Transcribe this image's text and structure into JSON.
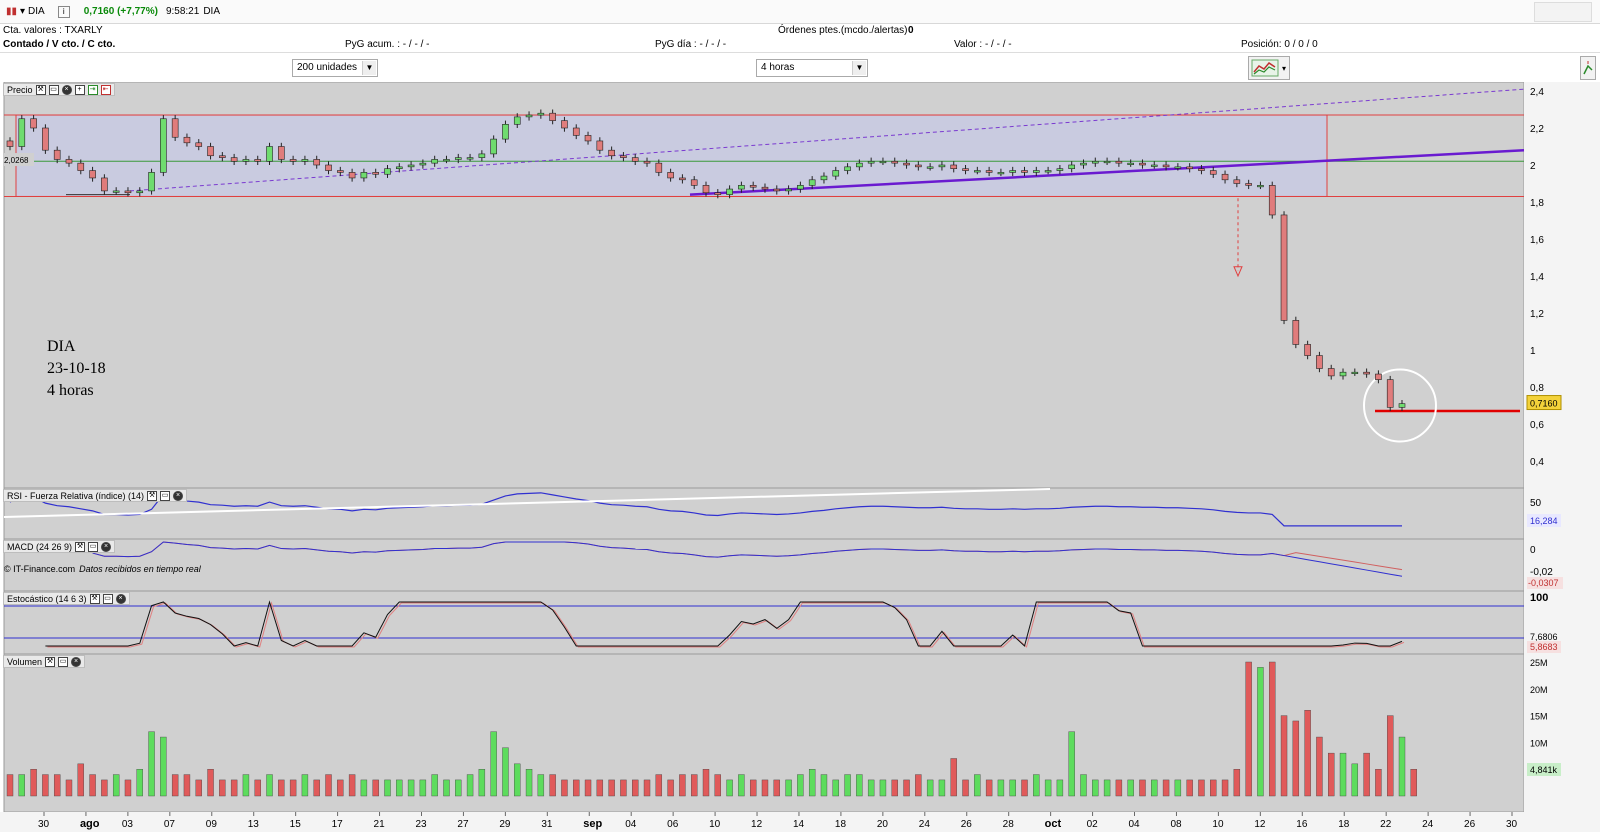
{
  "header": {
    "symbol": "DIA",
    "price": "0,7160 (+7,77%)",
    "time": "9:58:21",
    "symbol2": "DIA"
  },
  "account": {
    "cta_label": "Cta. valores : TXARLY",
    "ordenes_label": "Órdenes ptes.(mcdo./alertas)",
    "ordenes_value": "0",
    "contado": "Contado / V cto. / C cto.",
    "pyg_acum": "PyG acum. : - / - / -",
    "pyg_dia": "PyG día : - / - / -",
    "valor": "Valor : - / - / -",
    "posicion": "Posición: 0 / 0 / 0"
  },
  "toolbar": {
    "units": "200 unidades",
    "interval": "4 horas"
  },
  "panels": {
    "precio": "Precio",
    "rsi": "RSI - Fuerza Relativa (índice) (14)",
    "macd": "MACD (24 26 9)",
    "estocastico": "Estocástico (14 6 3)",
    "volumen": "Volumen"
  },
  "annotation": {
    "line1": "DIA",
    "line2": "23-10-18",
    "line3": "4 horas"
  },
  "credit": {
    "source": "© IT-Finance.com",
    "realtime": "Datos recibidos en tiempo real"
  },
  "price_axis": {
    "ticks": [
      "2,4",
      "2,2",
      "2",
      "1,8",
      "1,6",
      "1,4",
      "1,2",
      "1",
      "0,8",
      "0,6",
      "0,4"
    ],
    "current": "0,7160",
    "left_marker": "2,0268"
  },
  "rsi_axis": {
    "tick": "50",
    "current": "16,284"
  },
  "macd_axis": {
    "ticks": [
      "0",
      "-0,02"
    ],
    "current": "-0,0307"
  },
  "stoch_axis": {
    "tick": "100",
    "k": "7,6806",
    "d": "5,8683"
  },
  "vol_axis": {
    "ticks": [
      "25M",
      "20M",
      "15M",
      "10M"
    ],
    "current": "4,841k"
  },
  "date_axis": [
    "30",
    "ago",
    "03",
    "07",
    "09",
    "13",
    "15",
    "17",
    "21",
    "23",
    "27",
    "29",
    "31",
    "sep",
    "04",
    "06",
    "10",
    "12",
    "14",
    "18",
    "20",
    "24",
    "26",
    "28",
    "oct",
    "02",
    "04",
    "08",
    "10",
    "12",
    "16",
    "18",
    "22",
    "24",
    "26",
    "30"
  ],
  "chart_data": {
    "type": "candlestick",
    "interval": "4 horas",
    "closes": [
      2.1,
      2.25,
      2.2,
      2.08,
      2.03,
      2.01,
      1.97,
      1.93,
      1.86,
      1.86,
      1.85,
      1.86,
      1.96,
      2.25,
      2.15,
      2.12,
      2.1,
      2.05,
      2.04,
      2.02,
      2.03,
      2.02,
      2.1,
      2.03,
      2.02,
      2.03,
      2.0,
      1.97,
      1.96,
      1.93,
      1.96,
      1.95,
      1.98,
      1.99,
      2.0,
      2.01,
      2.03,
      2.03,
      2.04,
      2.04,
      2.06,
      2.14,
      2.22,
      2.26,
      2.27,
      2.28,
      2.24,
      2.2,
      2.16,
      2.13,
      2.08,
      2.05,
      2.04,
      2.02,
      2.01,
      1.96,
      1.93,
      1.92,
      1.89,
      1.85,
      1.84,
      1.87,
      1.89,
      1.88,
      1.87,
      1.86,
      1.87,
      1.89,
      1.92,
      1.94,
      1.97,
      1.99,
      2.01,
      2.02,
      2.02,
      2.01,
      2.0,
      1.99,
      1.99,
      2.0,
      1.98,
      1.97,
      1.97,
      1.96,
      1.96,
      1.97,
      1.96,
      1.97,
      1.97,
      1.98,
      2.0,
      2.01,
      2.02,
      2.02,
      2.01,
      2.01,
      2.0,
      2.0,
      1.99,
      1.99,
      1.98,
      1.97,
      1.95,
      1.92,
      1.9,
      1.89,
      1.89,
      1.73,
      1.16,
      1.03,
      0.97,
      0.9,
      0.86,
      0.88,
      0.88,
      0.87,
      0.84,
      0.69,
      0.71
    ],
    "volume_millions": [
      4,
      4,
      5,
      4,
      4,
      3,
      6,
      4,
      3,
      4,
      3,
      5,
      12,
      11,
      4,
      4,
      3,
      5,
      3,
      3,
      4,
      3,
      4,
      3,
      3,
      4,
      3,
      4,
      3,
      4,
      3,
      3,
      3,
      3,
      3,
      3,
      4,
      3,
      3,
      4,
      5,
      12,
      9,
      6,
      5,
      4,
      4,
      3,
      3,
      3,
      3,
      3,
      3,
      3,
      3,
      4,
      3,
      4,
      4,
      5,
      4,
      3,
      4,
      3,
      3,
      3,
      3,
      4,
      5,
      4,
      3,
      4,
      4,
      3,
      3,
      3,
      3,
      4,
      3,
      3,
      7,
      3,
      4,
      3,
      3,
      3,
      3,
      4,
      3,
      3,
      12,
      4,
      3,
      3,
      3,
      3,
      3,
      3,
      3,
      3,
      3,
      3,
      3,
      3,
      5,
      25,
      24,
      25,
      15,
      14,
      16,
      11,
      8,
      8,
      6,
      8,
      5,
      15,
      11,
      5
    ],
    "y_range": [
      0.3,
      2.45
    ]
  }
}
